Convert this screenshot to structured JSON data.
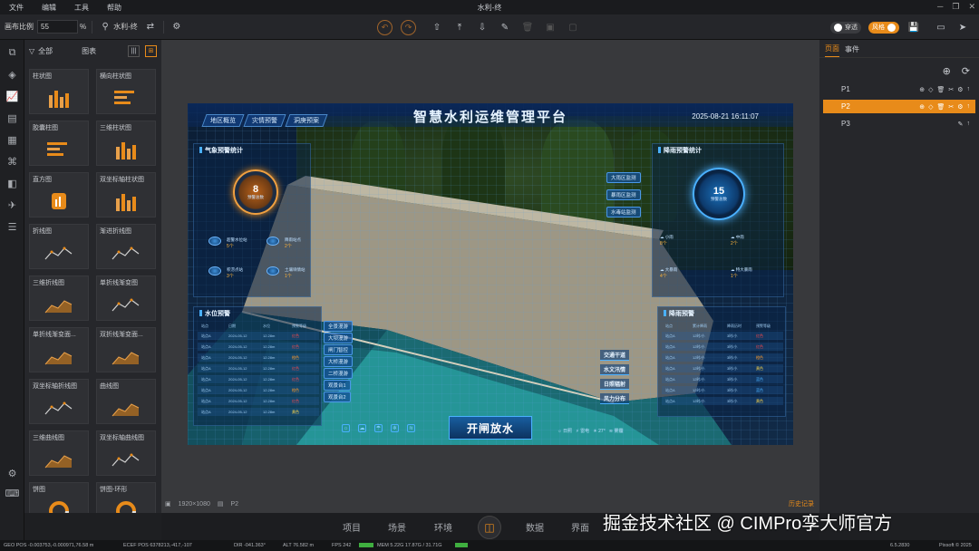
{
  "menu": {
    "items": [
      "文件",
      "编辑",
      "工具",
      "帮助"
    ],
    "title": "水利-终"
  },
  "toolbar": {
    "scale_label": "画布比例",
    "scale_value": "55",
    "scale_unit": "%",
    "project_name": "水利-终",
    "toggle_transparent": "穿透",
    "toggle_style": "风格"
  },
  "left_panel": {
    "filter_label": "全部",
    "category": "图表",
    "cards": [
      {
        "label": "柱状图",
        "icon": "bars"
      },
      {
        "label": "横向柱状图",
        "icon": "hbars"
      },
      {
        "label": "胶囊柱图",
        "icon": "hbars"
      },
      {
        "label": "三维柱状图",
        "icon": "bars"
      },
      {
        "label": "直方图",
        "icon": "hist"
      },
      {
        "label": "双坐标轴柱状图",
        "icon": "bars"
      },
      {
        "label": "折线图",
        "icon": "line"
      },
      {
        "label": "渐进折线图",
        "icon": "line"
      },
      {
        "label": "三维折线图",
        "icon": "area"
      },
      {
        "label": "单折线渐变图",
        "icon": "line"
      },
      {
        "label": "单折线渐变面...",
        "icon": "area"
      },
      {
        "label": "双折线渐变面...",
        "icon": "area"
      },
      {
        "label": "双坐标轴折线图",
        "icon": "line"
      },
      {
        "label": "曲线图",
        "icon": "area"
      },
      {
        "label": "三维曲线图",
        "icon": "area"
      },
      {
        "label": "双坐标轴曲线图",
        "icon": "line"
      },
      {
        "label": "饼图",
        "icon": "pie"
      },
      {
        "label": "饼图-环形",
        "icon": "pie"
      }
    ]
  },
  "screen": {
    "title": "智慧水利运维管理平台",
    "tabs": [
      "地区概览",
      "灾情预警",
      "洞庚预案"
    ],
    "datetime": "2025-08-21 16:11:07",
    "weather_panel": {
      "title": "气象预警统计",
      "gauge_value": "8",
      "gauge_label": "预警总数",
      "stats": [
        {
          "label": "超警水位站",
          "value": "5个"
        },
        {
          "label": "降雨站点",
          "value": "2个"
        },
        {
          "label": "积涝点站",
          "value": "3个"
        },
        {
          "label": "土壤墒情站",
          "value": "1个"
        }
      ]
    },
    "rain_panel": {
      "title": "降雨预警统计",
      "gauge_value": "15",
      "gauge_label": "预警总数",
      "tags": [
        "大雨区监测",
        "暴雨区监测",
        "水毒站监测"
      ],
      "stats": [
        {
          "label": "小雨",
          "value": "8个"
        },
        {
          "label": "中雨",
          "value": "2个"
        },
        {
          "label": "大暴雨",
          "value": "4个"
        },
        {
          "label": "特大暴雨",
          "value": "1个"
        }
      ]
    },
    "water_panel": {
      "title": "水位预警",
      "headers": [
        "站点",
        "日期",
        "水位",
        "预警等级"
      ],
      "rows": [
        [
          "站点A",
          "2024-05-12",
          "12.28m",
          "红色"
        ],
        [
          "站点A",
          "2024-05-12",
          "12.28m",
          "红色"
        ],
        [
          "站点A",
          "2024-05-12",
          "12.28m",
          "橙色"
        ],
        [
          "站点A",
          "2024-05-12",
          "12.28m",
          "红色"
        ],
        [
          "站点A",
          "2024-05-12",
          "12.28m",
          "红色"
        ],
        [
          "站点A",
          "2024-05-12",
          "12.28m",
          "橙色"
        ],
        [
          "站点A",
          "2024-05-12",
          "12.28m",
          "红色"
        ],
        [
          "站点A",
          "2024-05-12",
          "12.28m",
          "黄色"
        ]
      ]
    },
    "rainfall_panel": {
      "title": "降雨预警",
      "headers": [
        "站点",
        "累计降雨",
        "降雨历时",
        "预警等级"
      ],
      "rows": [
        [
          "站点A",
          "12时/小",
          "3时/小",
          "红色"
        ],
        [
          "站点A",
          "12时/小",
          "3时/小",
          "红色"
        ],
        [
          "站点A",
          "12时/小",
          "3时/小",
          "橙色"
        ],
        [
          "站点A",
          "12时/小",
          "3时/小",
          "黄色"
        ],
        [
          "站点A",
          "12时/小",
          "3时/小",
          "蓝色"
        ],
        [
          "站点A",
          "12时/小",
          "3时/小",
          "蓝色"
        ],
        [
          "站点A",
          "12时/小",
          "3时/小",
          "黄色"
        ]
      ]
    },
    "left_tags": [
      "全景漫游",
      "大坝漫游",
      "闸门智控",
      "大桥漫游",
      "二桥漫游",
      "观景台1",
      "观景台2"
    ],
    "right_buttons": [
      "交通干道",
      "水文汛情",
      "日照辐射",
      "风力分布"
    ],
    "main_button": "开闸放水",
    "weather_bar": [
      "日照",
      "雷电",
      "27°",
      "雾霾"
    ]
  },
  "canvas_status": {
    "size": "1920×1080",
    "page": "P2",
    "history": "历史记录"
  },
  "right_panel": {
    "tabs": [
      "页面",
      "事件"
    ],
    "pages": [
      "P1",
      "P2",
      "P3"
    ],
    "selected": "P2"
  },
  "bottom_nav": [
    "项目",
    "场景",
    "环境",
    "数据",
    "界面"
  ],
  "watermark": "掘金技术社区 @ CIMPro孪大师官方",
  "status": {
    "geo": "GEO POS  -0.003753,-0.000971,76.58 m",
    "ecef": "ECEF POS  6378213,-417,-107",
    "dir": "DIR  -041.363°",
    "alt": "ALT  76.582 m",
    "fps": "FPS  242",
    "mem": "MEM  5.22G  17.87G / 31.71G",
    "version": "6.5.2830",
    "copyright": "Pixsoft © 2025"
  },
  "colors": {
    "accent": "#e88b1a",
    "panel": "#26272b",
    "screen_blue": "#4ab0ff"
  }
}
